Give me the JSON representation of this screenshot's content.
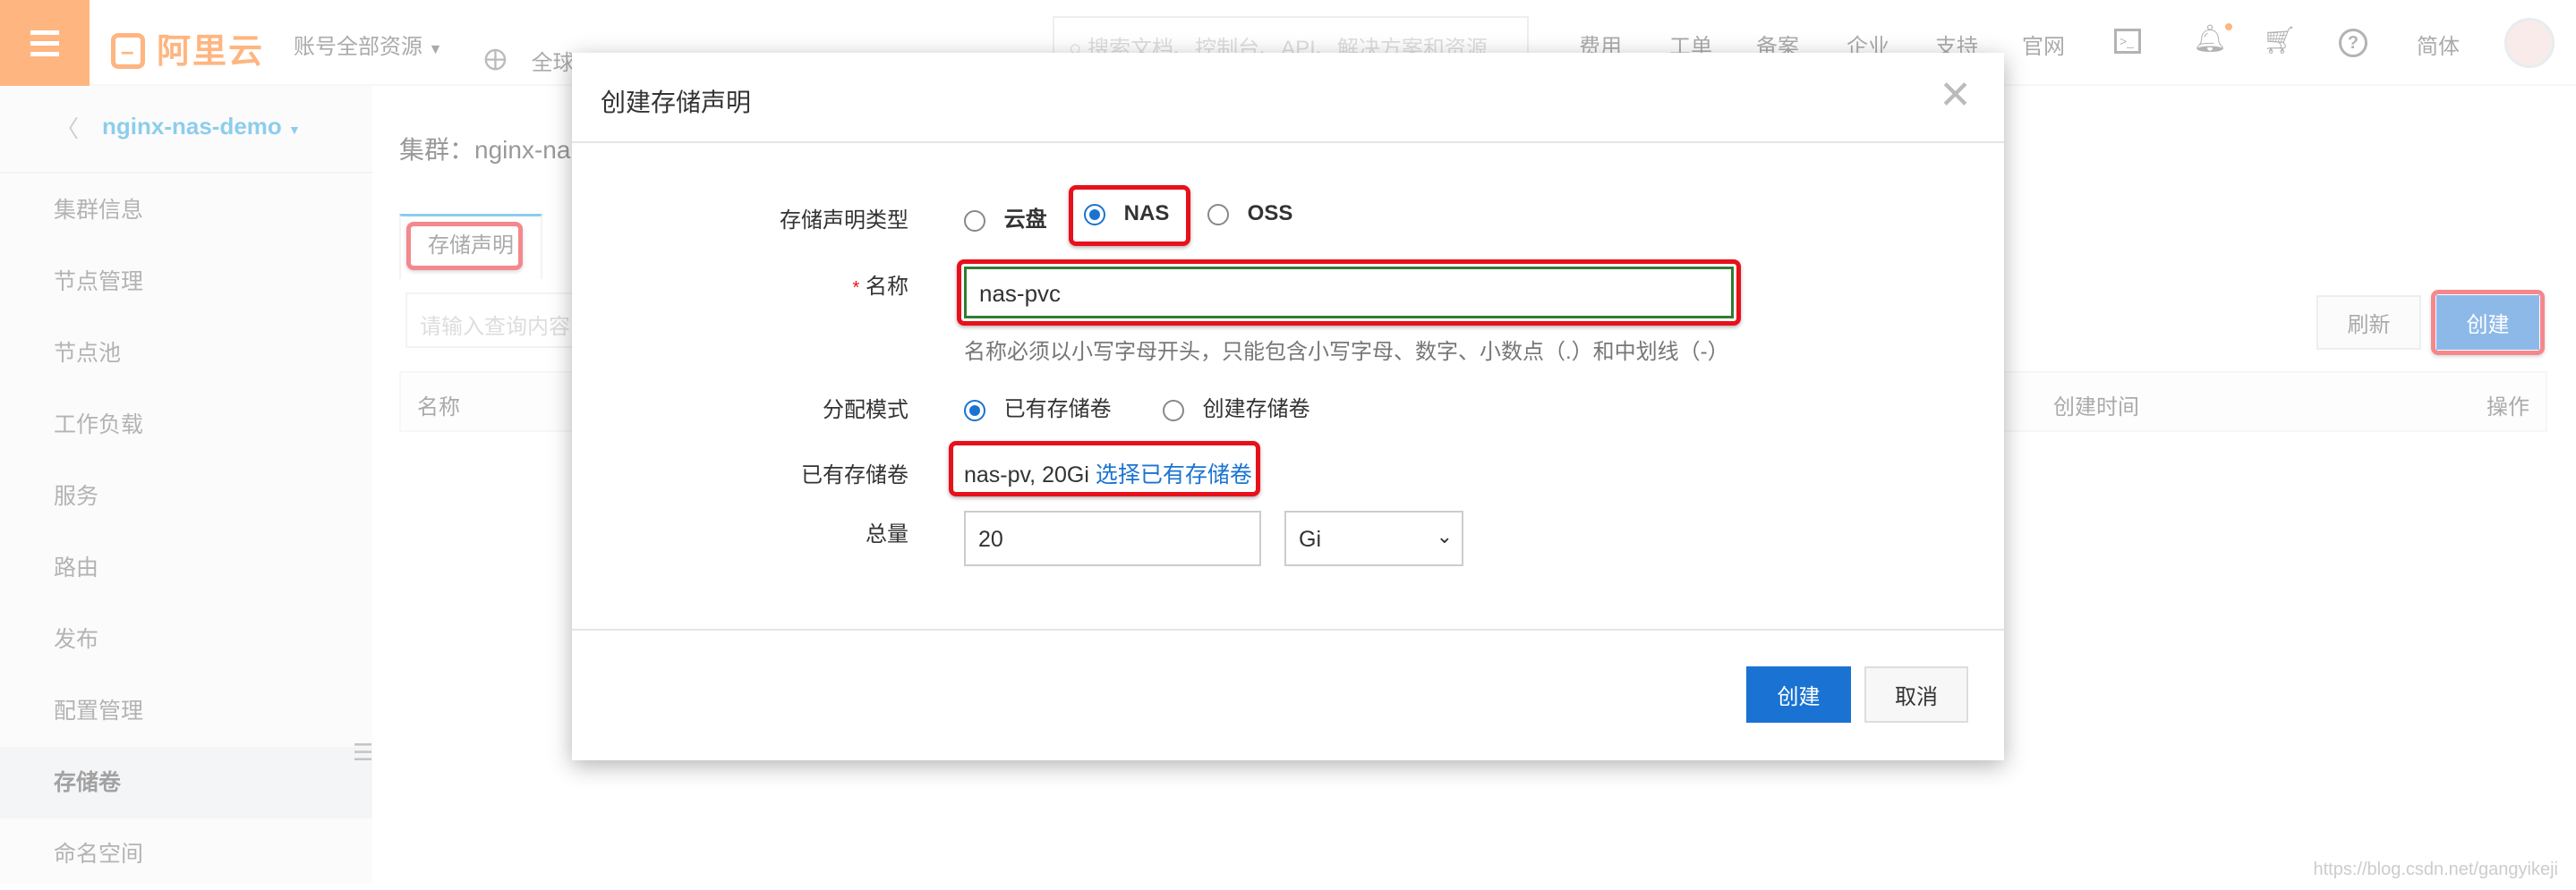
{
  "topbar": {
    "logo": "阿里云",
    "account": "账号全部资源",
    "region": "全球",
    "search_placeholder": "搜索文档、控制台、API、解决方案和资源",
    "nav": [
      "费用",
      "工单",
      "备案",
      "企业",
      "支持",
      "官网"
    ],
    "lang": "简体",
    "icons": [
      "terminal-icon",
      "bell-icon",
      "cart-icon",
      "help-icon"
    ],
    "accent": "#ff6a00"
  },
  "sidebar": {
    "cluster": "nginx-nas-demo",
    "items": [
      "集群信息",
      "节点管理",
      "节点池",
      "工作负载",
      "服务",
      "路由",
      "发布",
      "配置管理",
      "存储卷",
      "命名空间"
    ],
    "active": "存储卷"
  },
  "main": {
    "title": "集群：nginx-na",
    "tab": "存储声明",
    "search_placeholder": "请输入查询内容",
    "refresh": "刷新",
    "create": "创建",
    "columns": [
      "名称",
      "创建时间",
      "操作"
    ]
  },
  "modal": {
    "title": "创建存储声明",
    "type_label": "存储声明类型",
    "type_options": [
      "云盘",
      "NAS",
      "OSS"
    ],
    "type_selected": "NAS",
    "name_label": "名称",
    "required_mark": "*",
    "name_value": "nas-pvc",
    "name_help": "名称必须以小写字母开头，只能包含小写字母、数字、小数点（.）和中划线（-）",
    "mode_label": "分配模式",
    "mode_options": [
      "已有存储卷",
      "创建存储卷"
    ],
    "mode_selected": "已有存储卷",
    "pv_label": "已有存储卷",
    "pv_value": "nas-pv, 20Gi",
    "pv_link": "选择已有存储卷",
    "total_label": "总量",
    "total_value": "20",
    "unit": "Gi",
    "ok": "创建",
    "cancel": "取消",
    "primary_color": "#1a73d2"
  },
  "watermark": "https://blog.csdn.net/gangyikeji"
}
